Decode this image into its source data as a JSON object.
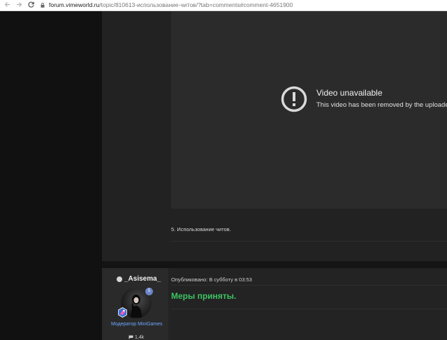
{
  "browser": {
    "back_icon": "arrow-left-icon",
    "forward_icon": "arrow-right-icon",
    "reload_icon": "reload-icon",
    "lock_icon": "lock-icon",
    "url_host": "forum.vimeworld.ru",
    "url_path": "/topic/810613-использование-читов/?tab=comments#comment-4651900"
  },
  "video": {
    "icon": "alert-circle-icon",
    "title": "Video unavailable",
    "subtitle": "This video has been removed by the uploader"
  },
  "post": {
    "text": "5. Использование читов."
  },
  "reply": {
    "author": "_Asisema_",
    "online_indicator": "online-dot-icon",
    "group": "Модератор MiniGames",
    "reputation_icon": "comment-bubble-icon",
    "reputation": "1,4k",
    "meta": "Опубликовано: В субботу в 03:53",
    "heading": "Меры приняты.",
    "heading_color": "#3cc363",
    "group_color": "#6fa8ff",
    "rank_badge": "rank-badge-icon"
  }
}
